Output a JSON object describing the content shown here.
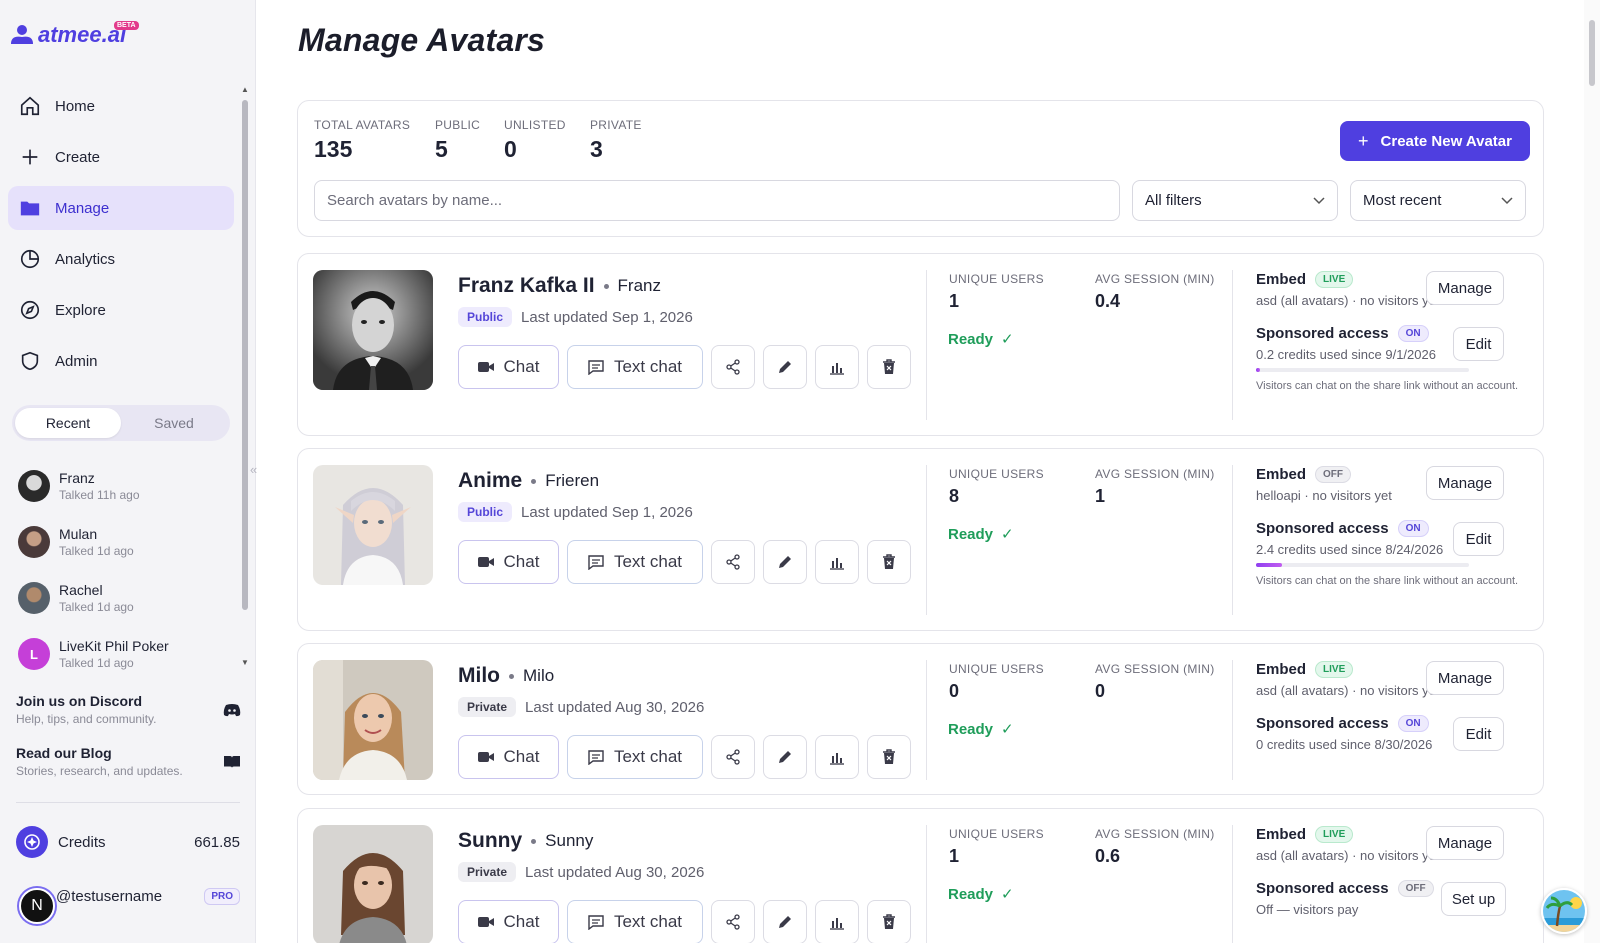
{
  "brand": {
    "name": "atmee.ai",
    "beta": "BETA"
  },
  "nav": [
    {
      "label": "Home",
      "icon": "home-icon"
    },
    {
      "label": "Create",
      "icon": "plus-icon"
    },
    {
      "label": "Manage",
      "icon": "folder-icon",
      "active": true
    },
    {
      "label": "Analytics",
      "icon": "pie-chart-icon"
    },
    {
      "label": "Explore",
      "icon": "compass-icon"
    },
    {
      "label": "Admin",
      "icon": "shield-icon"
    }
  ],
  "tabs": {
    "recent": "Recent",
    "saved": "Saved"
  },
  "recent": [
    {
      "name": "Franz",
      "sub": "Talked 11h ago"
    },
    {
      "name": "Mulan",
      "sub": "Talked 1d ago"
    },
    {
      "name": "Rachel",
      "sub": "Talked 1d ago"
    },
    {
      "name": "LiveKit Phil Poker",
      "sub": "Talked 1d ago",
      "initial": "L"
    }
  ],
  "collapse": "«",
  "promos": {
    "discord": {
      "title": "Join us on Discord",
      "sub": "Help, tips, and community."
    },
    "blog": {
      "title": "Read our Blog",
      "sub": "Stories, research, and updates."
    }
  },
  "credits": {
    "label": "Credits",
    "value": "661.85"
  },
  "user": {
    "handle": "@testusername",
    "plan": "PRO",
    "initial": "N"
  },
  "page": {
    "title": "Manage Avatars"
  },
  "stats": {
    "total": {
      "label": "TOTAL AVATARS",
      "value": "135"
    },
    "public": {
      "label": "PUBLIC",
      "value": "5"
    },
    "unlisted": {
      "label": "UNLISTED",
      "value": "0"
    },
    "private": {
      "label": "PRIVATE",
      "value": "3"
    }
  },
  "create_button": "Create New Avatar",
  "search": {
    "placeholder": "Search avatars by name..."
  },
  "filters": {
    "all": "All filters",
    "sort": "Most recent"
  },
  "labels": {
    "chat": "Chat",
    "text_chat": "Text chat",
    "unique_users": "UNIQUE USERS",
    "avg_session": "AVG SESSION (MIN)",
    "ready": "Ready",
    "embed": "Embed",
    "sponsored": "Sponsored access",
    "manage": "Manage",
    "edit": "Edit",
    "setup": "Set up",
    "visitors_note": "Visitors can chat on the share link without an account."
  },
  "avatars": [
    {
      "name": "Franz Kafka II",
      "alias": "Franz",
      "visibility": "Public",
      "updated": "Last updated Sep 1, 2026",
      "unique_users": "1",
      "avg_session": "0.4",
      "embed_status": "LIVE",
      "embed_detail": "asd (all avatars) · no visitors yet",
      "sponsored_status": "ON",
      "sponsored_detail": "0.2 credits used since 9/1/2026",
      "usage": 0.02
    },
    {
      "name": "Anime",
      "alias": "Frieren",
      "visibility": "Public",
      "updated": "Last updated Sep 1, 2026",
      "unique_users": "8",
      "avg_session": "1",
      "embed_status": "OFF",
      "embed_detail": "helloapi · no visitors yet",
      "sponsored_status": "ON",
      "sponsored_detail": "2.4 credits used since 8/24/2026",
      "usage": 0.12
    },
    {
      "name": "Milo",
      "alias": "Milo",
      "visibility": "Private",
      "updated": "Last updated Aug 30, 2026",
      "unique_users": "0",
      "avg_session": "0",
      "embed_status": "LIVE",
      "embed_detail": "asd (all avatars) · no visitors yet",
      "sponsored_status": "ON",
      "sponsored_detail": "0 credits used since 8/30/2026"
    },
    {
      "name": "Sunny",
      "alias": "Sunny",
      "visibility": "Private",
      "updated": "Last updated Aug 30, 2026",
      "unique_users": "1",
      "avg_session": "0.6",
      "embed_status": "LIVE",
      "embed_detail": "asd (all avatars) · no visitors yet",
      "sponsored_status": "OFF",
      "sponsored_detail": "Off — visitors pay"
    }
  ]
}
